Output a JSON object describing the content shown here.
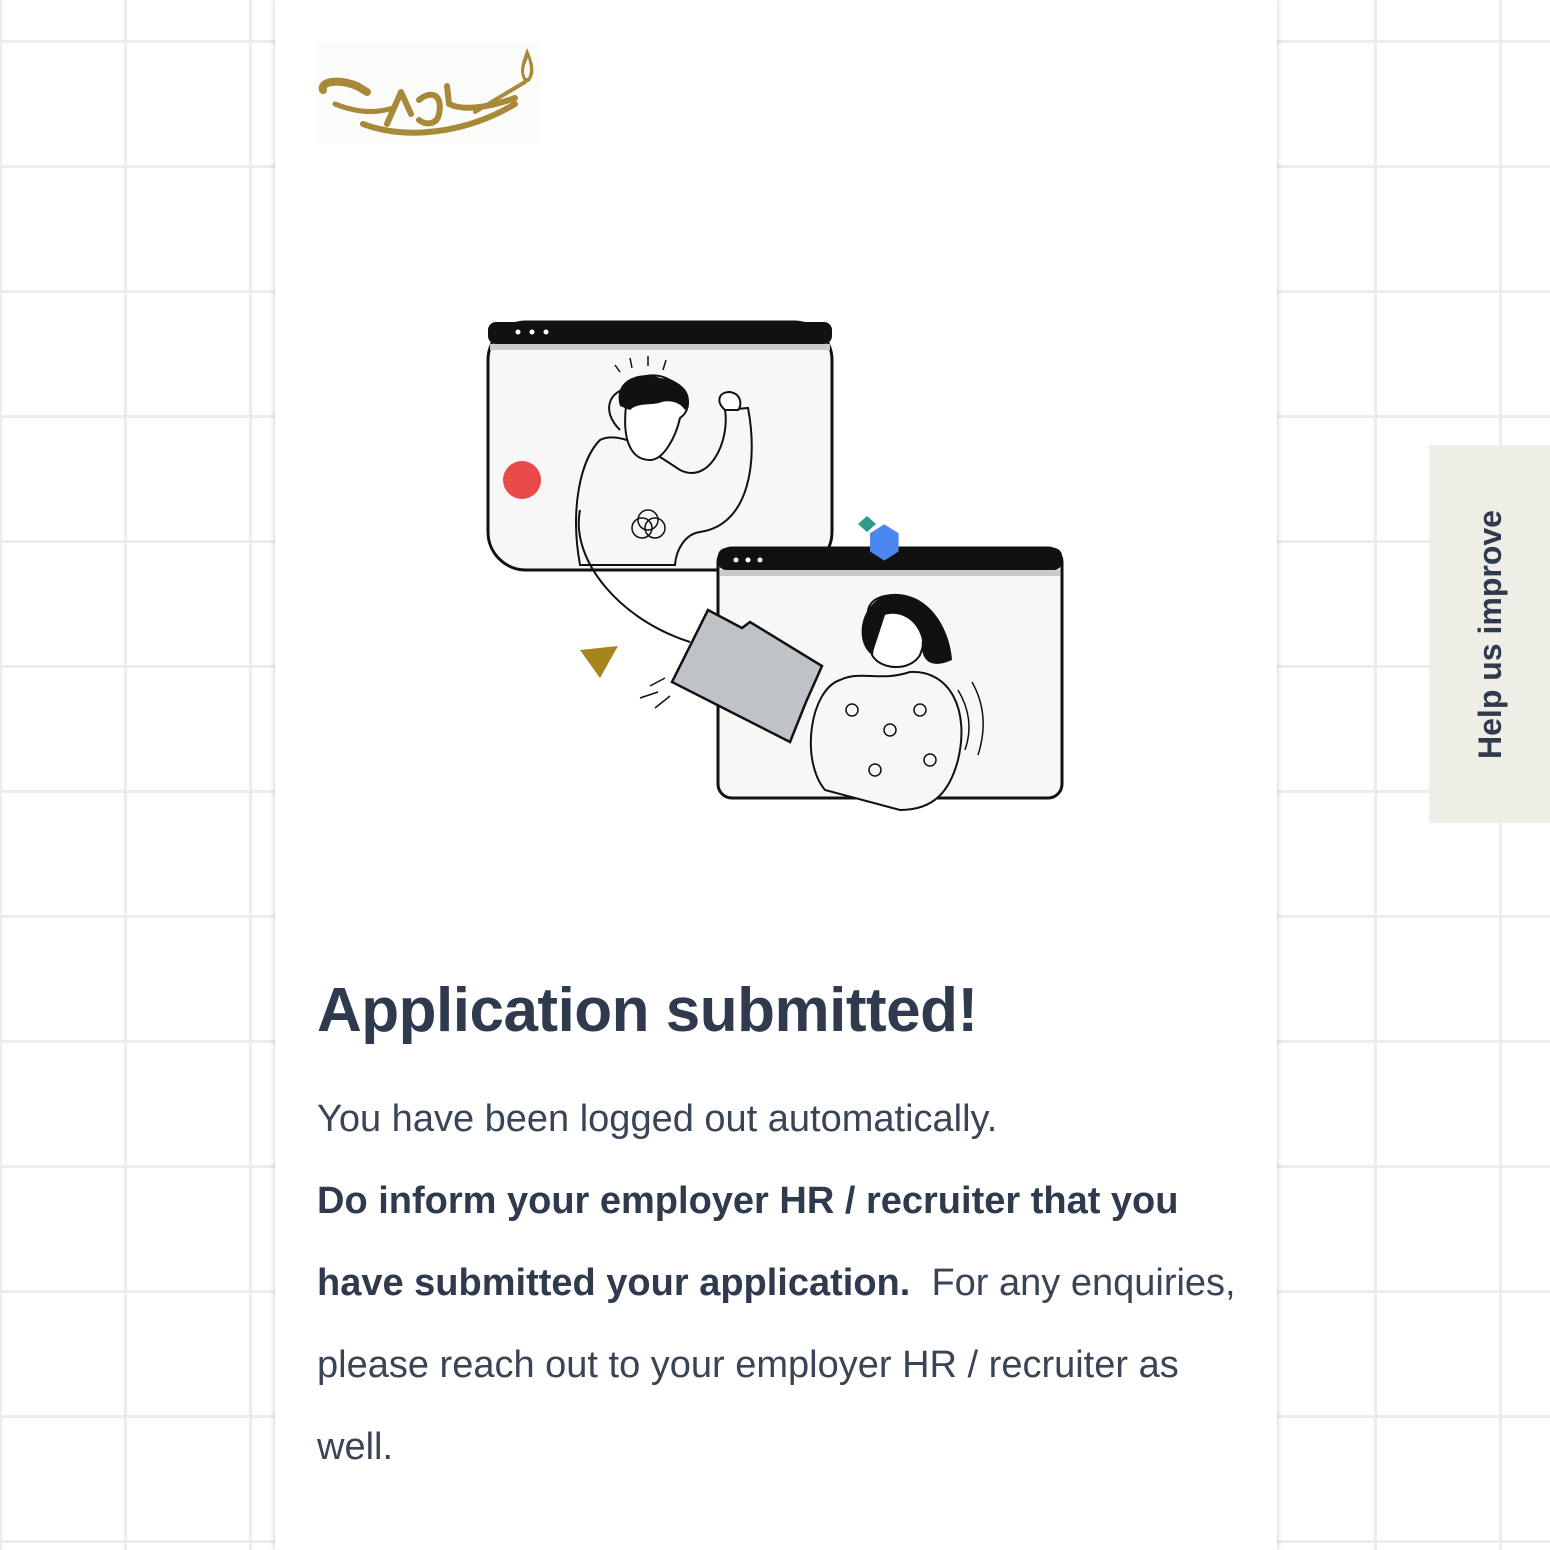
{
  "brand": {
    "logo_name": "lamp-logo",
    "logo_color": "#a8893a"
  },
  "illustration": {
    "name": "document-handoff-illustration"
  },
  "main": {
    "title": "Application submitted!",
    "logged_out_text": "You have been logged out automatically.",
    "inform_bold": "Do inform your employer HR / recruiter that you have submitted your application.",
    "enquiries_text": "For any enquiries, please reach out to your employer HR / recruiter as well."
  },
  "feedback_tab": {
    "label": "Help us improve"
  },
  "colors": {
    "text_primary": "#2f3a4e",
    "tab_bg": "#efeee6",
    "accent_gold": "#a8893a"
  }
}
